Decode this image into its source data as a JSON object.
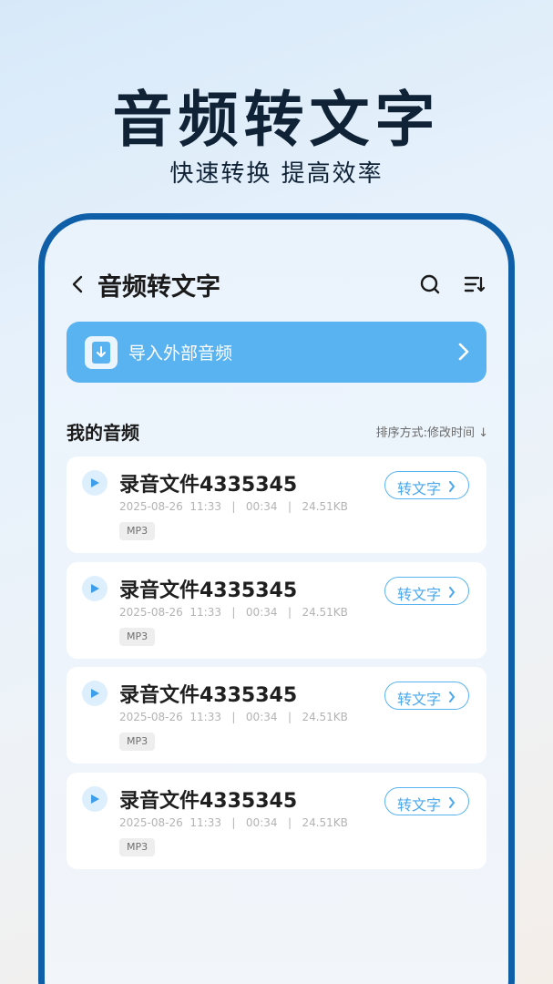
{
  "promo": {
    "title": "音频转文字",
    "subtitle": "快速转换 提高效率"
  },
  "header": {
    "title": "音频转文字",
    "icons": [
      "back-icon",
      "search-icon",
      "sort-list-icon"
    ]
  },
  "import": {
    "label": "导入外部音频",
    "icon": "download-file-icon"
  },
  "section": {
    "title": "我的音频",
    "sort_label": "排序方式:修改时间 ↓"
  },
  "colors": {
    "accent": "#5ab3f1",
    "frame": "#0f5ea8"
  },
  "files": [
    {
      "name": "录音文件4335345",
      "date": "2025-08-26",
      "time": "11:33",
      "duration": "00:34",
      "size": "24.51KB",
      "format": "MP3",
      "action": "转文字"
    },
    {
      "name": "录音文件4335345",
      "date": "2025-08-26",
      "time": "11:33",
      "duration": "00:34",
      "size": "24.51KB",
      "format": "MP3",
      "action": "转文字"
    },
    {
      "name": "录音文件4335345",
      "date": "2025-08-26",
      "time": "11:33",
      "duration": "00:34",
      "size": "24.51KB",
      "format": "MP3",
      "action": "转文字"
    },
    {
      "name": "录音文件4335345",
      "date": "2025-08-26",
      "time": "11:33",
      "duration": "00:34",
      "size": "24.51KB",
      "format": "MP3",
      "action": "转文字"
    }
  ]
}
